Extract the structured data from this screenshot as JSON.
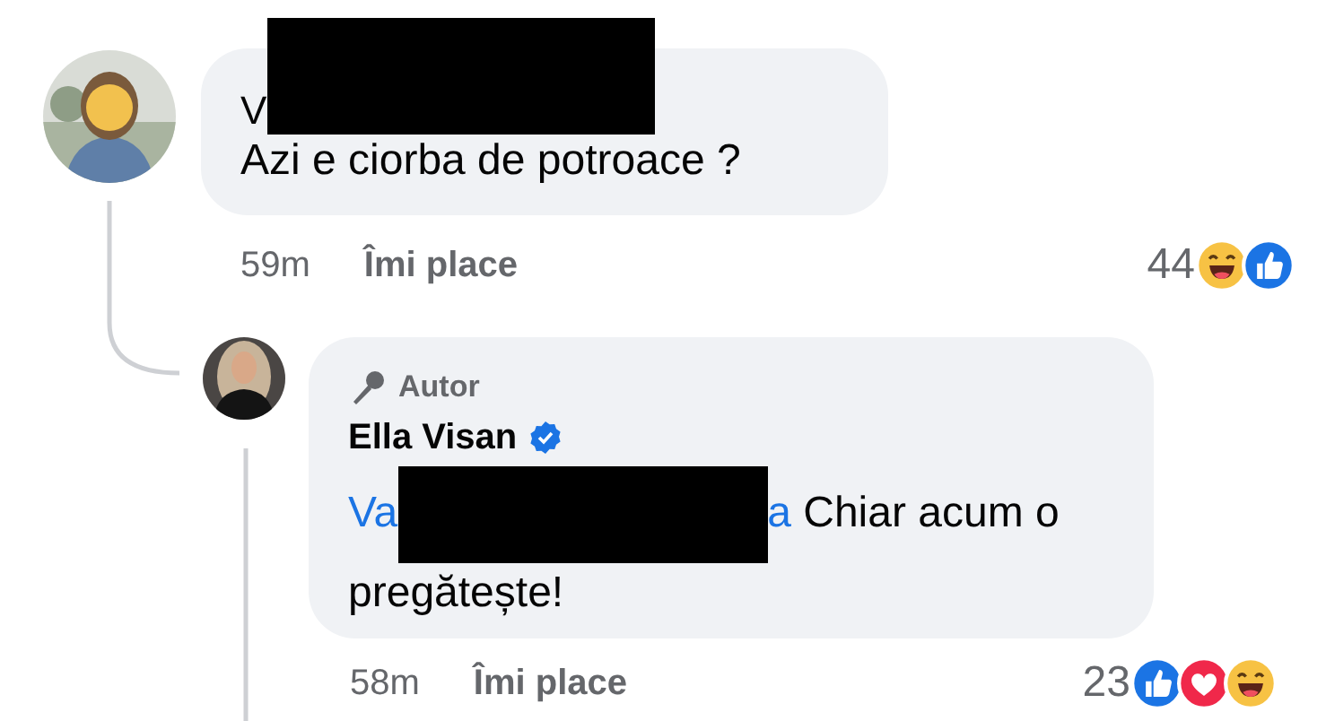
{
  "comment": {
    "author": "V",
    "redacted": true,
    "text": "Azi e ciorba de potroace ?",
    "time": "59m",
    "like_label": "Îmi place",
    "reaction_count": "44",
    "reactions": [
      {
        "kind": "haha"
      },
      {
        "kind": "like"
      }
    ]
  },
  "reply": {
    "badge": "Autor",
    "author": "Ella Visan",
    "verified": true,
    "mention_start": "Va",
    "redacted": true,
    "mention_end": "a",
    "text_lines": [
      "Chiar acum o",
      "pregătește!"
    ],
    "time": "58m",
    "like_label": "Îmi place",
    "reaction_count": "23",
    "reactions": [
      {
        "kind": "like"
      },
      {
        "kind": "love"
      },
      {
        "kind": "haha"
      }
    ]
  }
}
